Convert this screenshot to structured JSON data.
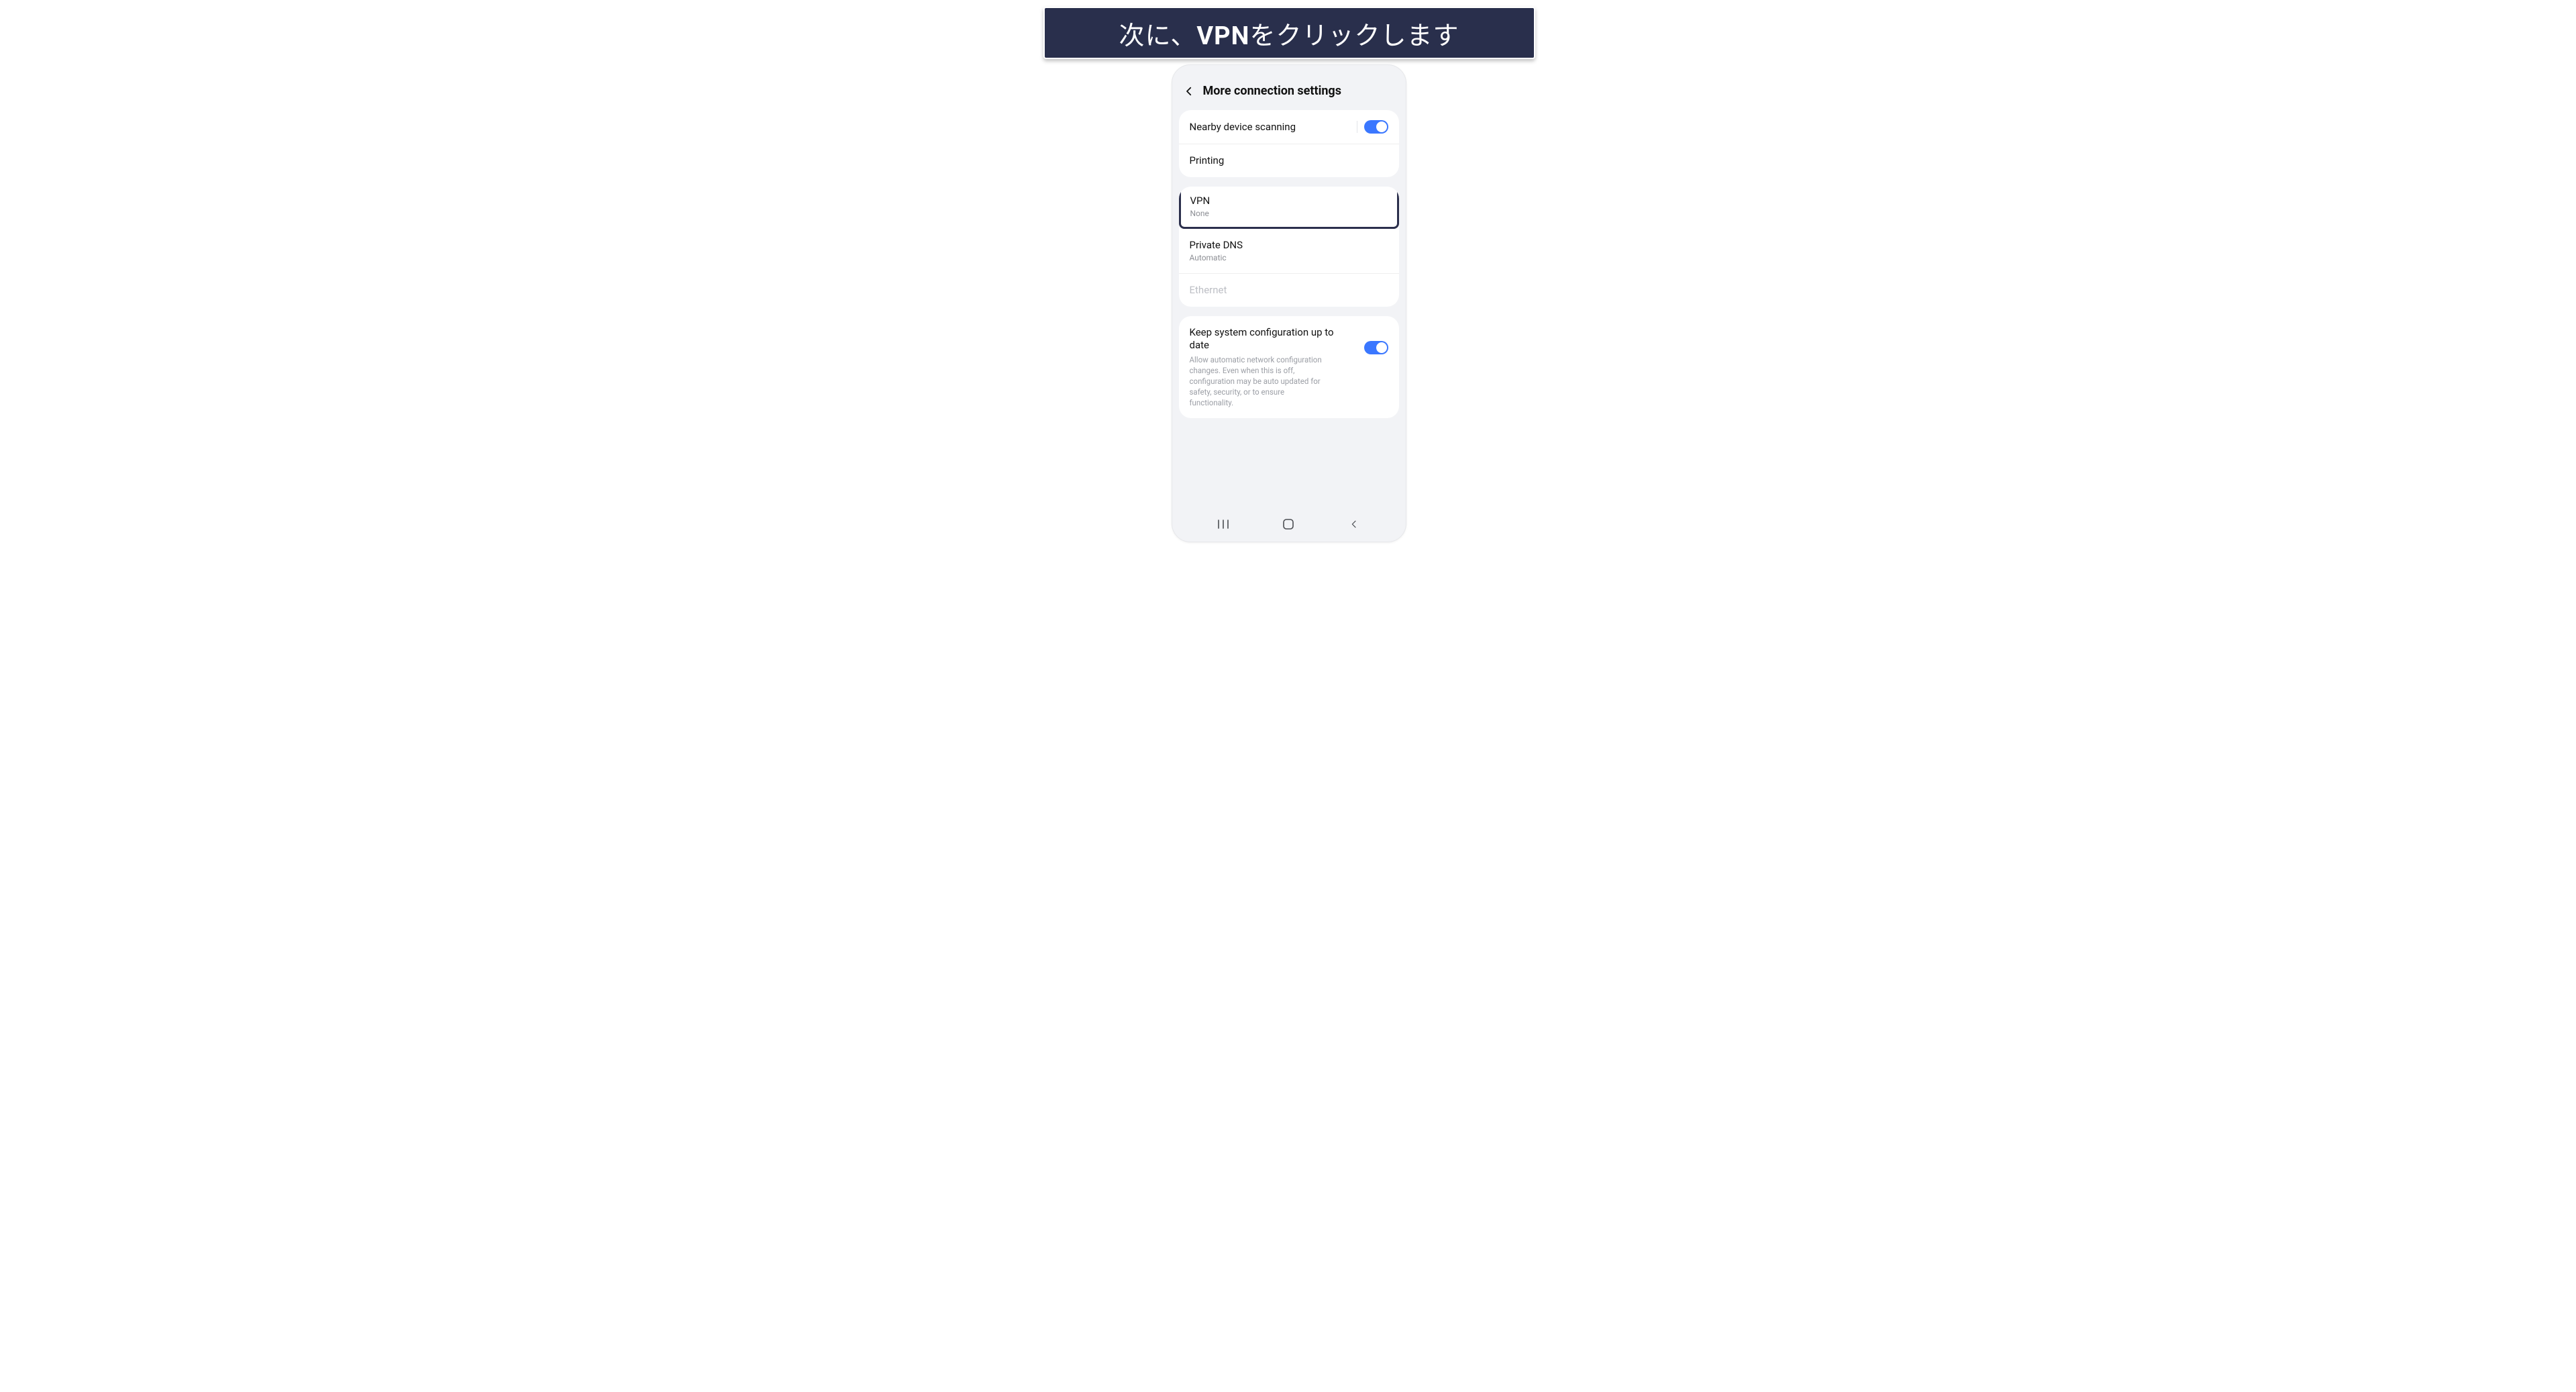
{
  "banner": {
    "prefix": "次に、",
    "bold": "VPN",
    "suffix": "をクリックします"
  },
  "header": {
    "title": "More connection settings"
  },
  "group1": {
    "nearby": {
      "label": "Nearby device scanning",
      "enabled": true
    },
    "printing": {
      "label": "Printing"
    }
  },
  "group2": {
    "vpn": {
      "label": "VPN",
      "sub": "None"
    },
    "private_dns": {
      "label": "Private DNS",
      "sub": "Automatic"
    },
    "ethernet": {
      "label": "Ethernet"
    }
  },
  "group3": {
    "keep_system": {
      "label": "Keep system configuration up to date",
      "desc": "Allow automatic network configuration changes. Even when this is off, configuration may be auto updated for safety, security, or to ensure functionality.",
      "enabled": true
    }
  },
  "colors": {
    "banner_bg": "#292f4c",
    "accent_blue": "#3a77ff",
    "highlight_border": "#2b2f4c"
  }
}
